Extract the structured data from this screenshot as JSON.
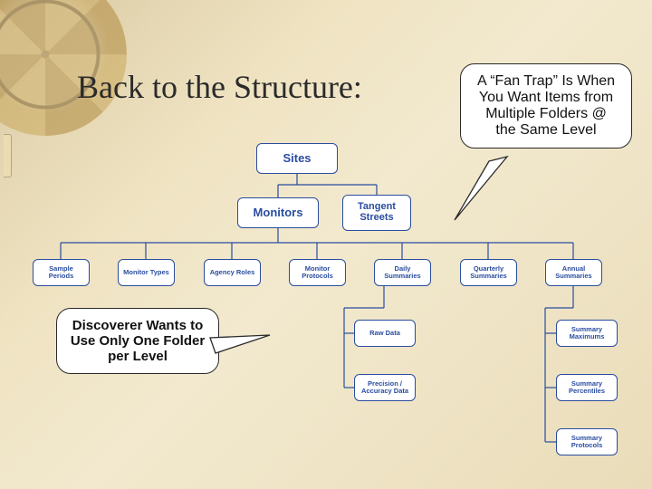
{
  "title": "Back to the Structure:",
  "callouts": {
    "fantrap": "A “Fan Trap” Is When You Want Items from Multiple Folders @ the Same Level",
    "discoverer": "Discoverer Wants to Use Only One Folder per Level"
  },
  "nodes": {
    "sites": "Sites",
    "monitors": "Monitors",
    "tangent": "Tangent Streets",
    "sample_periods": "Sample Periods",
    "monitor_types": "Monitor Types",
    "agency_roles": "Agency Roles",
    "monitor_protocols": "Monitor Protocols",
    "daily_summaries": "Daily Summaries",
    "quarterly_summaries": "Quarterly Summaries",
    "annual_summaries": "Annual Summaries",
    "raw_data": "Raw Data",
    "precision_accuracy": "Precision / Accuracy Data",
    "summary_maximums": "Summary Maximums",
    "summary_percentiles": "Summary Percentiles",
    "summary_protocols": "Summary Protocols"
  },
  "chart_data": {
    "type": "diagram",
    "title": "Back to the Structure:",
    "hierarchy": {
      "Sites": {
        "Monitors": {
          "Sample Periods": {},
          "Monitor Types": {},
          "Agency Roles": {},
          "Monitor Protocols": {},
          "Daily Summaries": {
            "Raw Data": {},
            "Precision / Accuracy Data": {}
          },
          "Quarterly Summaries": {},
          "Annual Summaries": {
            "Summary Maximums": {},
            "Summary Percentiles": {},
            "Summary Protocols": {}
          }
        },
        "Tangent Streets": {}
      }
    },
    "annotations": [
      "A “Fan Trap” Is When You Want Items from Multiple Folders @ the Same Level",
      "Discoverer Wants to Use Only One Folder per Level"
    ]
  }
}
